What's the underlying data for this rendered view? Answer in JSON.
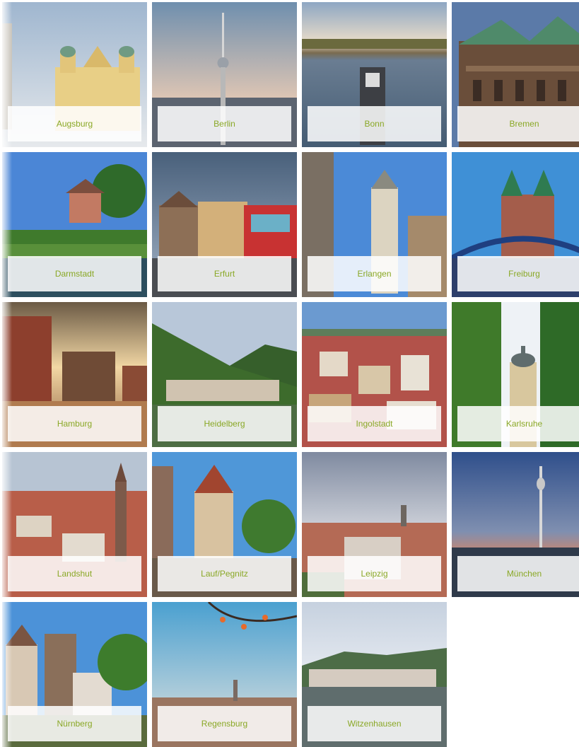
{
  "cities": [
    {
      "name": "Augsburg"
    },
    {
      "name": "Berlin"
    },
    {
      "name": "Bonn"
    },
    {
      "name": "Bremen"
    },
    {
      "name": "Darmstadt"
    },
    {
      "name": "Erfurt"
    },
    {
      "name": "Erlangen"
    },
    {
      "name": "Freiburg"
    },
    {
      "name": "Hamburg"
    },
    {
      "name": "Heidelberg"
    },
    {
      "name": "Ingolstadt"
    },
    {
      "name": "Karlsruhe"
    },
    {
      "name": "Landshut"
    },
    {
      "name": "Lauf/Pegnitz"
    },
    {
      "name": "Leipzig"
    },
    {
      "name": "München"
    },
    {
      "name": "Nürnberg"
    },
    {
      "name": "Regensburg"
    },
    {
      "name": "Witzenhausen"
    }
  ],
  "colors": {
    "label_text": "#8aa826",
    "label_bg": "#ffffff"
  }
}
